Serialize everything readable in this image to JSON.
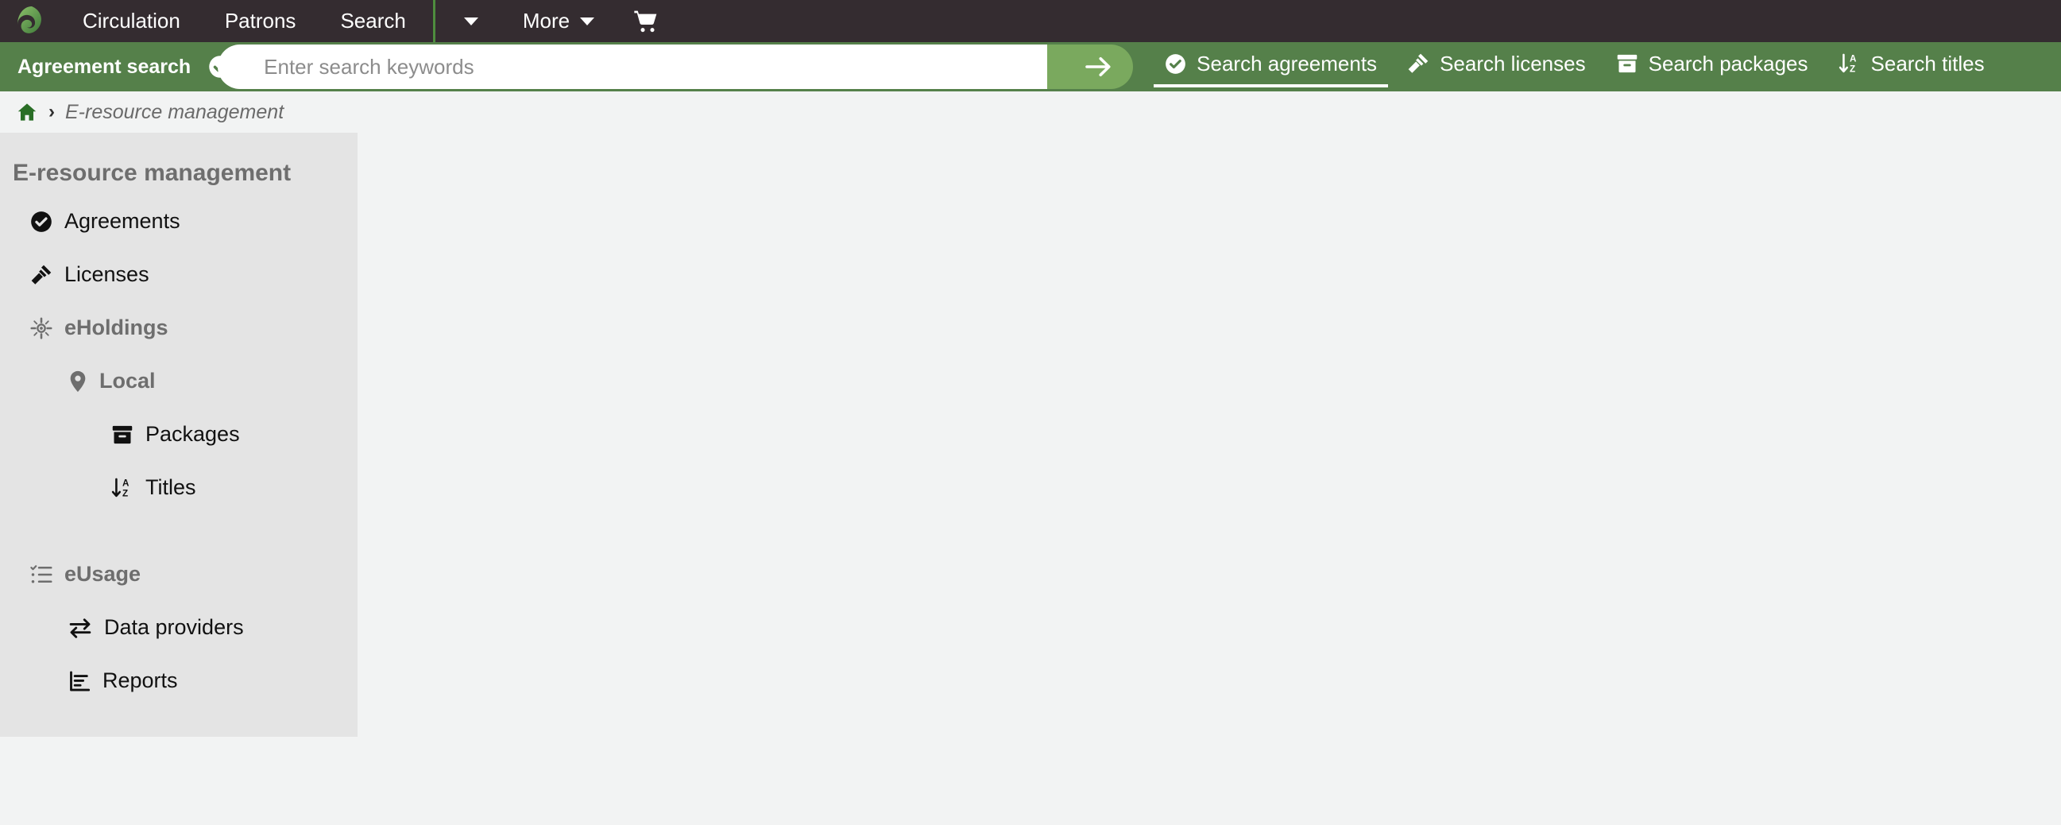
{
  "topnav": {
    "logo_icon": "folio-leaf-logo",
    "items": [
      {
        "label": "Circulation",
        "icon": ""
      },
      {
        "label": "Patrons",
        "icon": ""
      },
      {
        "label": "Search",
        "icon": ""
      }
    ],
    "overflow_caret_icon": "chevron-down-icon",
    "more_label": "More",
    "more_caret_icon": "chevron-down-icon",
    "cart_icon": "shopping-cart-icon",
    "bar_color": "#342c30",
    "divider_color": "#4e8d3e"
  },
  "searchbar": {
    "pill_label": "Agreement search",
    "pill_icon": "check-circle-icon",
    "input_value": "",
    "input_placeholder": "Enter search keywords",
    "submit_icon": "arrow-right-icon",
    "submit_color": "#7aa95e",
    "bar_color": "#55804a",
    "tabs": [
      {
        "label": "Search agreements",
        "icon": "check-circle-icon",
        "active": true
      },
      {
        "label": "Search licenses",
        "icon": "gavel-icon",
        "active": false
      },
      {
        "label": "Search packages",
        "icon": "archive-box-icon",
        "active": false
      },
      {
        "label": "Search titles",
        "icon": "sort-az-icon",
        "active": false
      }
    ]
  },
  "breadcrumb": {
    "home_icon": "home-icon",
    "separator": "›",
    "current": "E-resource management"
  },
  "sidebar": {
    "title": "E-resource management",
    "background": "#e4e4e4",
    "items": [
      {
        "label": "Agreements",
        "icon": "check-circle-icon",
        "level": 0,
        "muted": false,
        "spacer_before": false
      },
      {
        "label": "Licenses",
        "icon": "gavel-icon",
        "level": 0,
        "muted": false,
        "spacer_before": false
      },
      {
        "label": "eHoldings",
        "icon": "crosshair-icon",
        "level": 0,
        "muted": true,
        "spacer_before": false
      },
      {
        "label": "Local",
        "icon": "map-pin-icon",
        "level": 1,
        "muted": true,
        "spacer_before": false
      },
      {
        "label": "Packages",
        "icon": "archive-box-icon",
        "level": 2,
        "muted": false,
        "spacer_before": false
      },
      {
        "label": "Titles",
        "icon": "sort-az-icon",
        "level": 2,
        "muted": false,
        "spacer_before": false
      },
      {
        "label": "eUsage",
        "icon": "checklist-icon",
        "level": 0,
        "muted": true,
        "spacer_before": true
      },
      {
        "label": "Data providers",
        "icon": "exchange-icon",
        "level": 1,
        "muted": false,
        "spacer_before": false
      },
      {
        "label": "Reports",
        "icon": "bar-chart-icon",
        "level": 1,
        "muted": false,
        "spacer_before": false
      }
    ]
  },
  "colors": {
    "page_background": "#f2f3f3",
    "brand_green": "#55804a",
    "brand_green_light": "#7aa95e",
    "topbar_dark": "#342c30",
    "home_icon_green": "#2a6e26"
  }
}
